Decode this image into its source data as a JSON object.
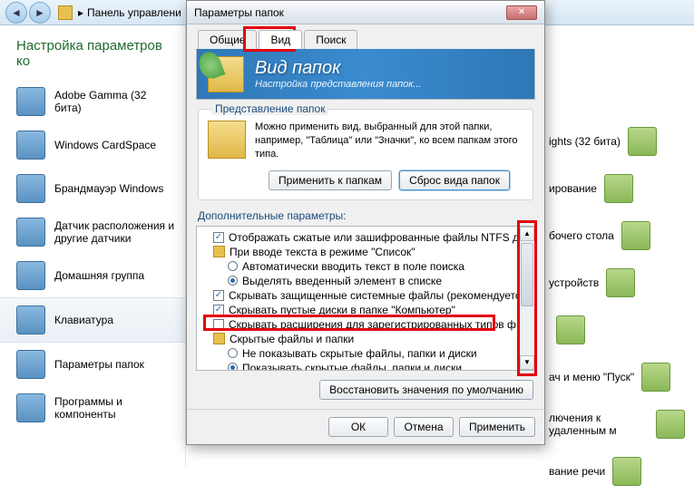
{
  "bg": {
    "address": "Панель управлени",
    "heading": "Настройка параметров ко",
    "items": [
      "Adobe Gamma (32 бита)",
      "Windows CardSpace",
      "Брандмауэр Windows",
      "Датчик расположения и другие датчики",
      "Домашняя группа",
      "Клавиатура",
      "Параметры папок",
      "Программы и компоненты"
    ],
    "right": [
      "ights (32 бита)",
      "ирование",
      "бочего стола",
      "устройств",
      "",
      "ач и меню \"Пуск\"",
      "лючения к удаленным м",
      "вание речи"
    ]
  },
  "dlg": {
    "title": "Параметры папок",
    "tabs": {
      "t1": "Общие",
      "t2": "Вид",
      "t3": "Поиск"
    },
    "banner": {
      "title": "Вид папок",
      "sub": "Настройка представления папок..."
    },
    "group": {
      "title": "Представление папок",
      "text": "Можно применить вид, выбранный для этой папки, например, \"Таблица\" или \"Значки\", ко всем папкам этого типа.",
      "apply": "Применить к папкам",
      "reset": "Сброс вида папок"
    },
    "advLabel": "Дополнительные параметры:",
    "tree": {
      "r0": "Отображать сжатые или зашифрованные файлы NTFS др",
      "r1": "При вводе текста в режиме \"Список\"",
      "r2": "Автоматически вводить текст в поле поиска",
      "r3": "Выделять введенный элемент в списке",
      "r4": "Скрывать защищенные системные файлы (рекомендуетс",
      "r5": "Скрывать пустые диски в папке \"Компьютер\"",
      "r6": "Скрывать расширения для зарегистрированных типов ф",
      "r7": "Скрытые файлы и папки",
      "r8": "Не показывать скрытые файлы, папки и диски",
      "r9": "Показывать скрытые файлы, папки и диски"
    },
    "restore": "Восстановить значения по умолчанию",
    "ok": "ОК",
    "cancel": "Отмена",
    "applyBtn": "Применить"
  }
}
